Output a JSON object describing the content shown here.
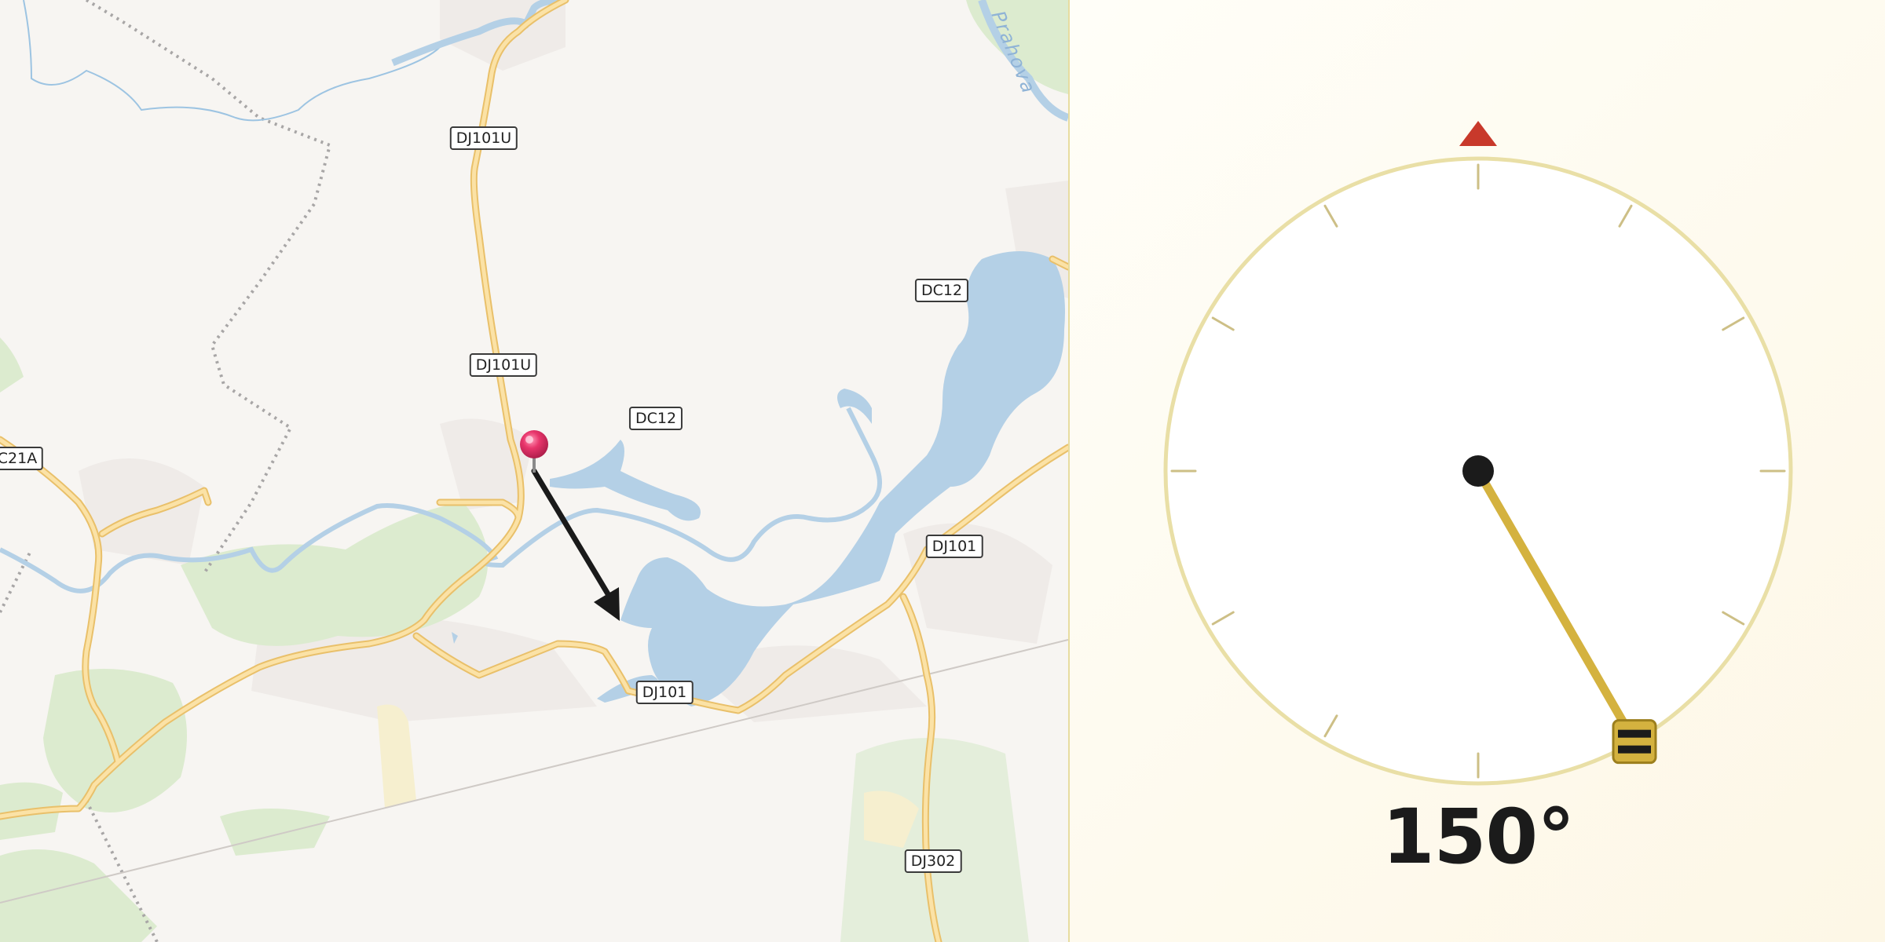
{
  "map": {
    "road_labels": [
      {
        "id": "dj101u-north",
        "text": "DJ101U"
      },
      {
        "id": "dj101u-mid",
        "text": "DJ101U"
      },
      {
        "id": "dc12-west",
        "text": "DC12"
      },
      {
        "id": "dc12-east",
        "text": "DC12"
      },
      {
        "id": "dc21a",
        "text": "C21A"
      },
      {
        "id": "dj101-east",
        "text": "DJ101"
      },
      {
        "id": "dj101-south",
        "text": "DJ101"
      },
      {
        "id": "dj302",
        "text": "DJ302"
      }
    ],
    "river_label": "Prahova",
    "colors": {
      "water": "#b4d0e6",
      "road": "#f3cf7e",
      "green": "#dcebcf",
      "pin": "#e8356b"
    }
  },
  "compass": {
    "heading_deg": 150,
    "heading_text": "150°",
    "colors": {
      "ring": "#e9dfa6",
      "needle": "#d4b23f",
      "north_marker": "#c8392b",
      "hub": "#1b1b1b"
    }
  }
}
